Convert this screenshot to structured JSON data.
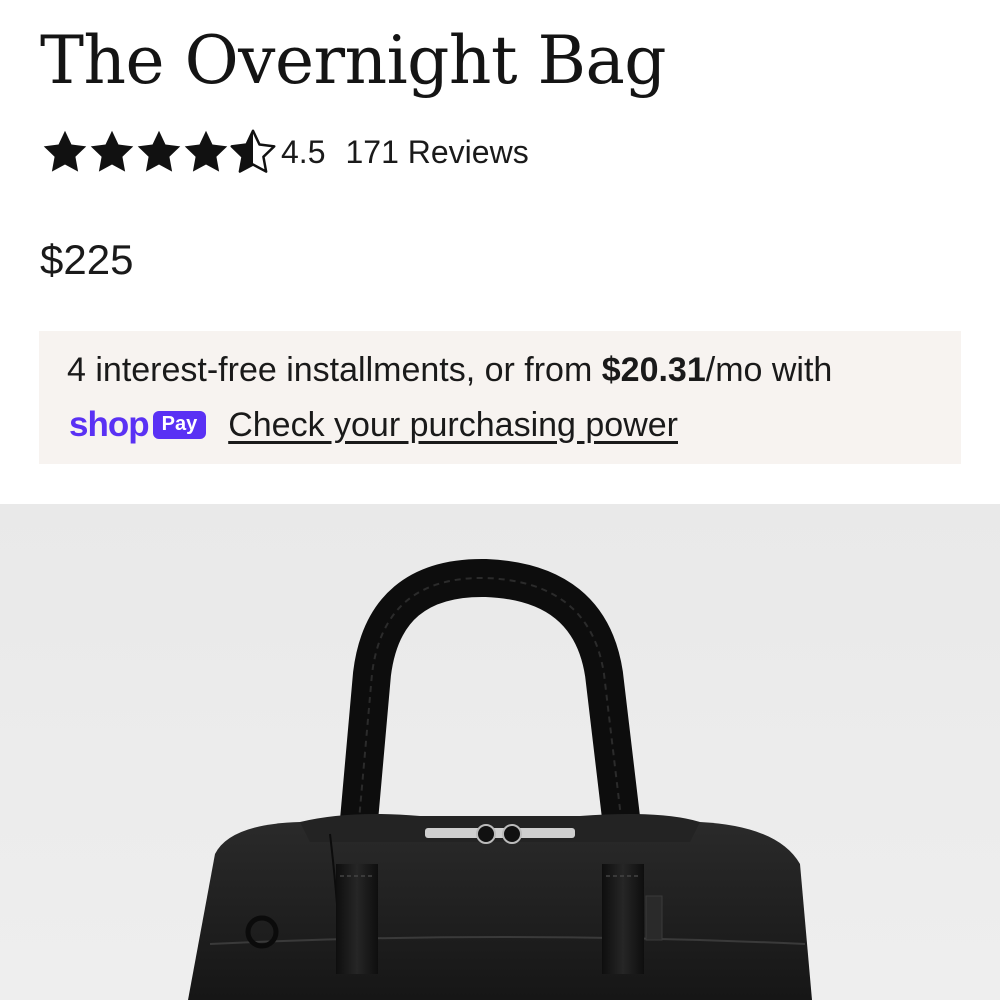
{
  "product": {
    "title": "The Overnight Bag",
    "rating": {
      "value": "4.5",
      "stars": 4.5,
      "max_stars": 5,
      "reviews_label": "171 Reviews"
    },
    "price": "$225"
  },
  "shop_pay": {
    "installments_prefix": "4 interest-free installments, or from ",
    "installment_amount": "$20.31",
    "installments_suffix": "/mo with",
    "logo_word": "shop",
    "logo_badge": "Pay",
    "link_label": "Check your purchasing power",
    "brand_color": "#5a31f4",
    "background_color": "#f7f3f0"
  },
  "image": {
    "subject": "black overnight bag with leather handles",
    "background_color": "#ececec",
    "bag_color": "#1c1c1c"
  }
}
